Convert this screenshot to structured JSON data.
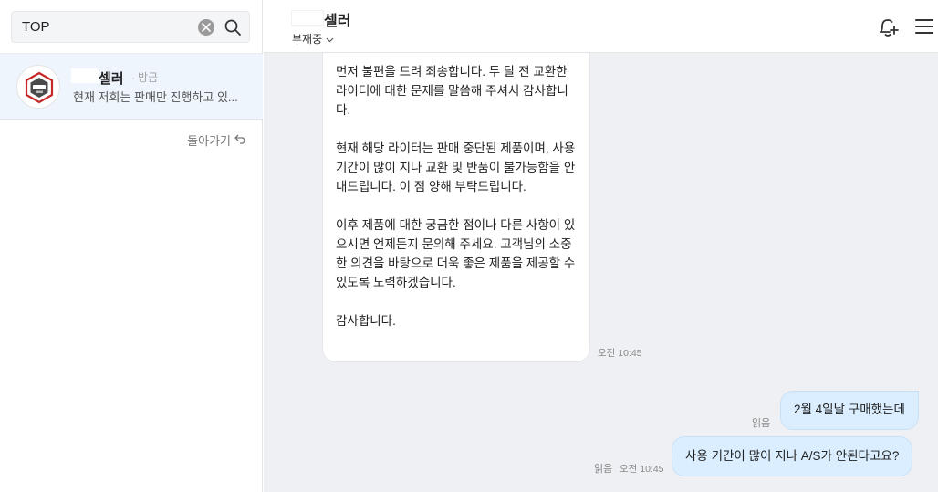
{
  "search": {
    "value": "TOP",
    "placeholder": ""
  },
  "chat_list": {
    "items": [
      {
        "name": "셀러",
        "time": "방금",
        "preview": "현재 저희는 판매만 진행하고 있..."
      }
    ],
    "back_label": "돌아가기"
  },
  "header": {
    "name": "셀러",
    "status": "부재중"
  },
  "messages": {
    "incoming": {
      "paragraphs": [
        "먼저 불편을 드려 죄송합니다. 두 달 전 교환한 라이터에 대한 문제를 말씀해 주셔서 감사합니다.",
        "현재 해당 라이터는 판매 중단된 제품이며, 사용 기간이 많이 지나 교환 및 반품이 불가능함을 안내드립니다. 이 점 양해 부탁드립니다.",
        "이후 제품에 대한 궁금한 점이나 다른 사항이 있으시면 언제든지 문의해 주세요. 고객님의 소중한 의견을 바탕으로 더욱 좋은 제품을 제공할 수 있도록 노력하겠습니다.",
        "감사합니다."
      ],
      "time": "오전 10:45"
    },
    "outgoing": [
      {
        "text": "2월 4일날 구매했는데",
        "read": "읽음",
        "time": ""
      },
      {
        "text": "사용 기간이 많이 지나 A/S가 안된다고요?",
        "read": "읽음",
        "time": "오전 10:45"
      }
    ]
  },
  "colors": {
    "selected_item_bg": "#eef5fc",
    "chat_bg": "#eef0f4",
    "outgoing_bubble": "#dbeeff",
    "avatar_accent": "#c62828"
  },
  "icons": {
    "search": "search-icon",
    "clear": "clear-icon",
    "bell": "bell-plus-icon",
    "menu": "hamburger-menu-icon",
    "back": "undo-arrow-icon",
    "status": "chevron-down-icon"
  }
}
